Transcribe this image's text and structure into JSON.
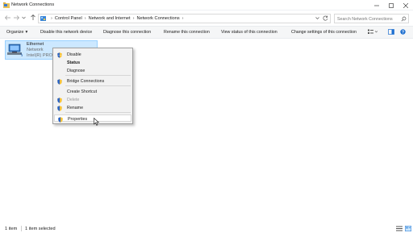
{
  "window": {
    "title": "Network Connections"
  },
  "address": {
    "crumbs": [
      "Control Panel",
      "Network and Internet",
      "Network Connections"
    ],
    "search_placeholder": "Search Network Connections"
  },
  "commands": {
    "organize": "Organize",
    "disable": "Disable this network device",
    "diagnose": "Diagnose this connection",
    "rename": "Rename this connection",
    "view_status": "View status of this connection",
    "change_settings": "Change settings of this connection"
  },
  "connection": {
    "name": "Ethernet",
    "network": "Network",
    "adapter": "Intel(R) PRO/"
  },
  "context_menu": {
    "disable": "Disable",
    "status": "Status",
    "diagnose": "Diagnose",
    "bridge": "Bridge Connections",
    "shortcut": "Create Shortcut",
    "delete": "Delete",
    "rename": "Rename",
    "properties": "Properties"
  },
  "status_bar": {
    "item_count": "1 item",
    "selected": "1 item selected"
  },
  "icons": {
    "window": "network-folder-icon",
    "back": "back-arrow-icon",
    "forward": "forward-arrow-icon",
    "recent": "chevron-down-icon",
    "up": "up-arrow-icon",
    "location": "control-panel-icon",
    "refresh": "refresh-icon",
    "search": "search-icon",
    "adapter": "ethernet-adapter-icon",
    "shield": "uac-shield-icon",
    "view_options": "view-options-icon",
    "preview_pane": "preview-pane-icon",
    "help": "help-icon",
    "details_view": "details-view-icon",
    "tiles_view": "tiles-view-icon"
  },
  "colors": {
    "selection_bg": "#cce8ff",
    "selection_border": "#99d1ff",
    "accent": "#0078d7"
  }
}
